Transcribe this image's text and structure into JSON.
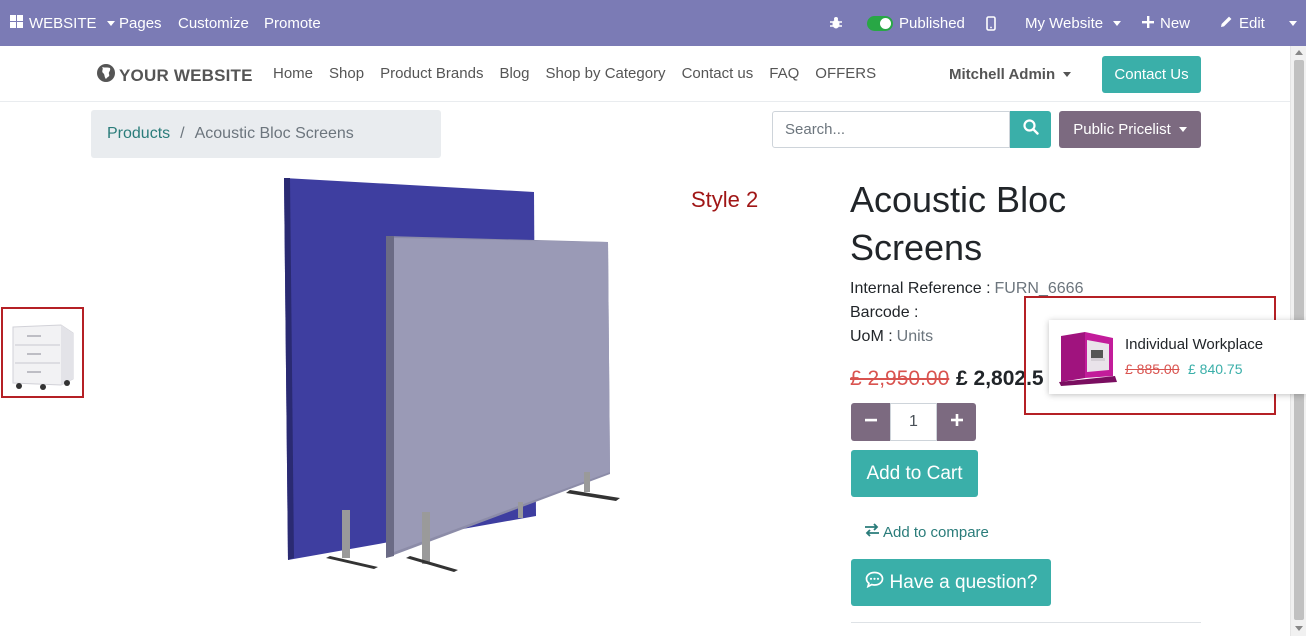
{
  "topbar": {
    "website_menu": "WEBSITE",
    "pages": "Pages",
    "customize": "Customize",
    "promote": "Promote",
    "published": "Published",
    "my_website": "My Website",
    "new": "New",
    "edit": "Edit"
  },
  "navbar": {
    "logo": "YOUR WEBSITE",
    "links": [
      "Home",
      "Shop",
      "Product Brands",
      "Blog",
      "Shop by Category",
      "Contact us",
      "FAQ",
      "OFFERS"
    ],
    "user": "Mitchell Admin",
    "contact_button": "Contact Us"
  },
  "breadcrumb": {
    "parent": "Products",
    "separator": "/",
    "current": "Acoustic Bloc Screens"
  },
  "search": {
    "placeholder": "Search..."
  },
  "pricelist": {
    "label": "Public Pricelist"
  },
  "gallery": {
    "style_label": "Style 2"
  },
  "product": {
    "title": "Acoustic Bloc Screens",
    "internal_reference_label": "Internal Reference :",
    "internal_reference_value": "FURN_6666",
    "barcode_label": "Barcode :",
    "uom_label": "UoM :",
    "uom_value": "Units",
    "old_price": "£ 2,950.00",
    "new_price": "£ 2,802.5",
    "quantity": "1",
    "add_to_cart": "Add to Cart",
    "add_to_compare": "Add to compare",
    "have_question": "Have a question?"
  },
  "popup": {
    "name": "Individual Workplace",
    "old_price": "£ 885.00",
    "new_price": "£ 840.75"
  },
  "colors": {
    "topbar": "#7b7bb5",
    "teal": "#3aafa9",
    "mauve": "#7c6a80",
    "highlight": "#b52025",
    "strike": "#d9534f"
  }
}
